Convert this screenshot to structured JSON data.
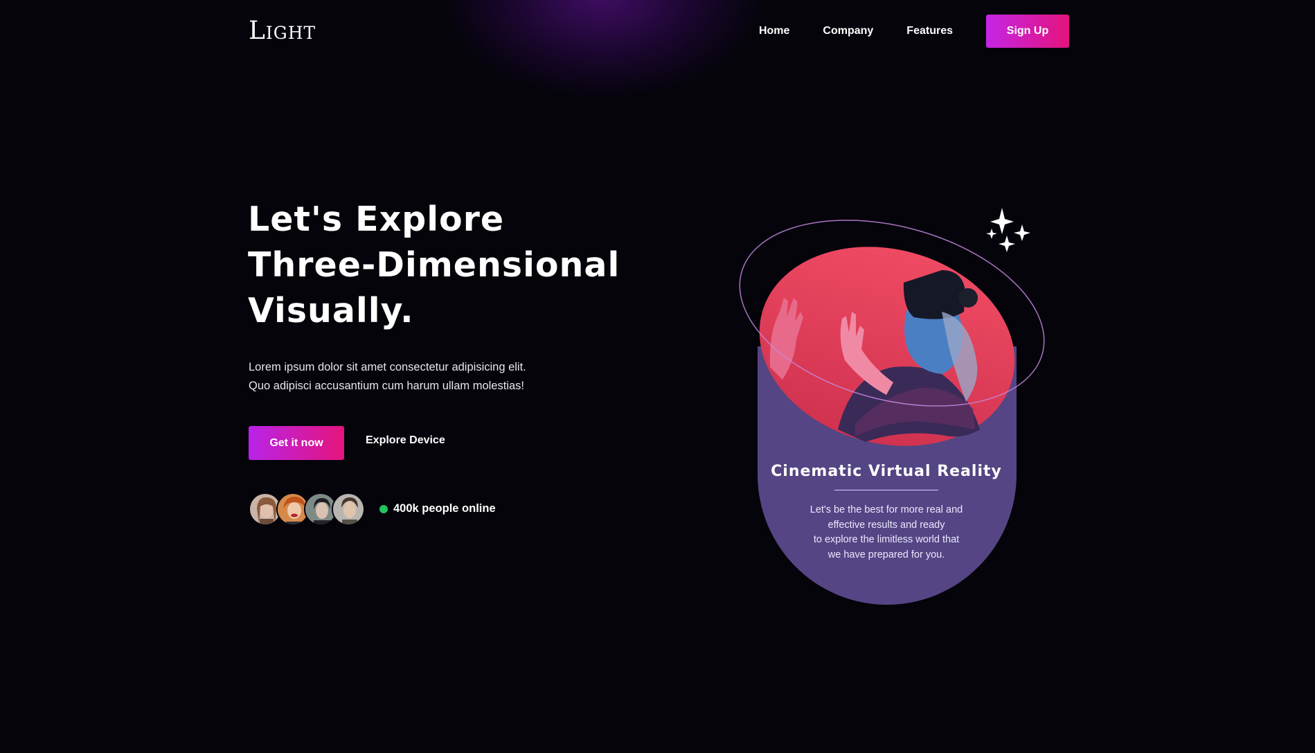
{
  "brand": {
    "logo": "Light"
  },
  "nav": {
    "items": [
      "Home",
      "Company",
      "Features"
    ],
    "signup": "Sign Up"
  },
  "hero": {
    "title_lines": [
      "Let's Explore",
      "Three-Dimensional",
      "Visually."
    ],
    "description_lines": [
      "Lorem ipsum dolor sit amet consectetur adipisicing elit.",
      "Quo adipisci accusantium cum harum ullam molestias!"
    ],
    "cta_primary": "Get it now",
    "cta_secondary": "Explore Device",
    "online_text": "400k people online"
  },
  "card": {
    "title": "Cinematic Virtual Reality",
    "text_lines": [
      "Let's be the best for more real and",
      "effective results and ready",
      "to explore the limitless world that",
      "we have prepared for you."
    ]
  },
  "colors": {
    "background": "#05040b",
    "accent_gradient_start": "#c326e6",
    "accent_gradient_end": "#e4137c",
    "card_purple": "#554584",
    "card_pink": "#e8405f",
    "online_dot": "#22c55e"
  }
}
